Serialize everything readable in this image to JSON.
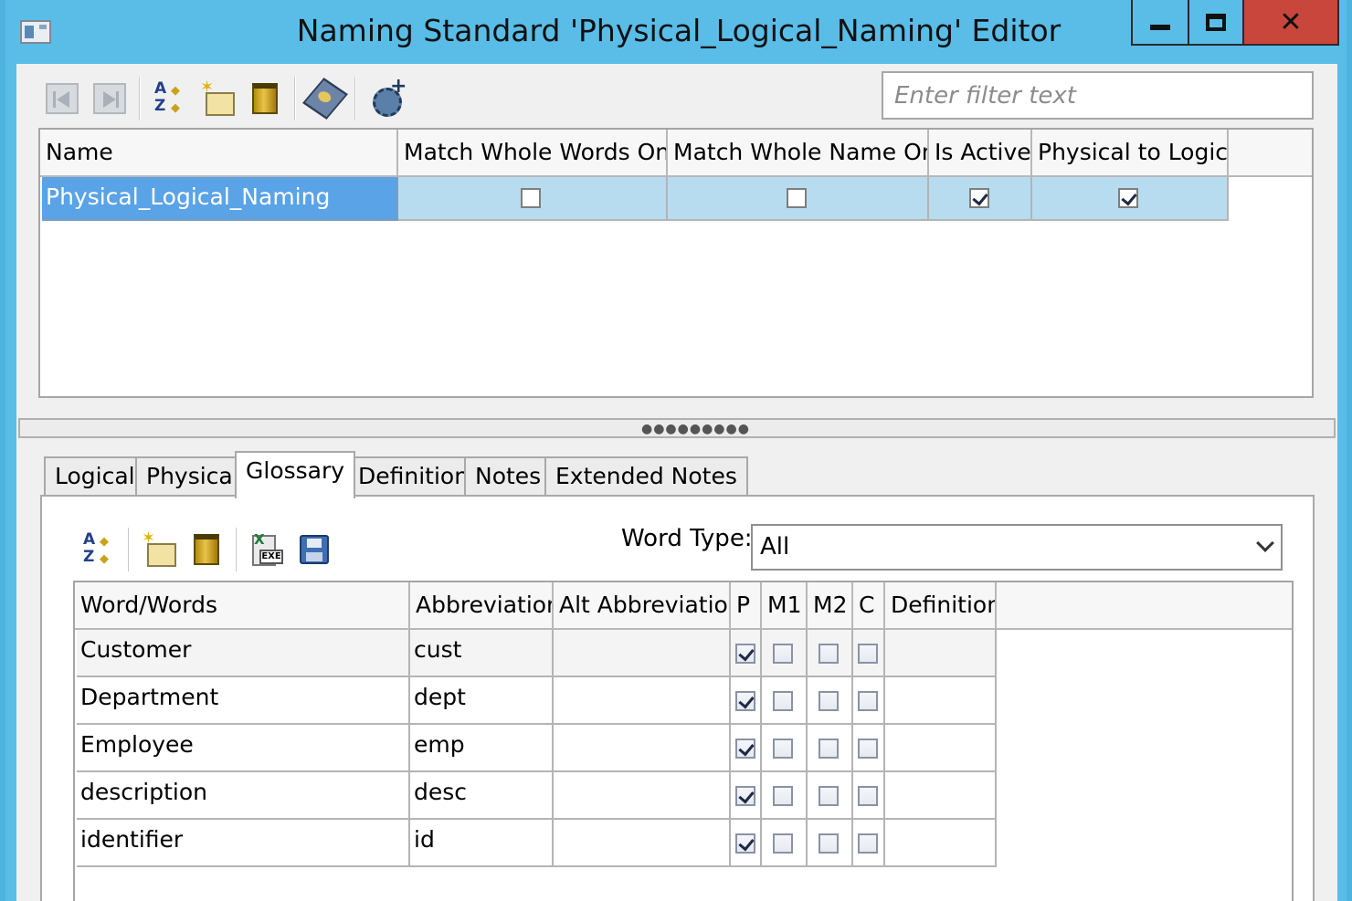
{
  "window": {
    "title": "Naming Standard 'Physical_Logical_Naming' Editor"
  },
  "toolbar": {
    "filter_placeholder": "Enter filter text"
  },
  "standards_table": {
    "columns": [
      "Name",
      "Match Whole Words Only",
      "Match Whole Name Only",
      "Is Active",
      "Physical to Logical"
    ],
    "rows": [
      {
        "name": "Physical_Logical_Naming",
        "match_whole_words_only": false,
        "match_whole_name_only": false,
        "is_active": true,
        "physical_to_logical": true,
        "selected": true
      }
    ]
  },
  "tabs": [
    {
      "label": "Logical",
      "active": false
    },
    {
      "label": "Physical",
      "active": false
    },
    {
      "label": "Glossary",
      "active": true
    },
    {
      "label": "Definition",
      "active": false
    },
    {
      "label": "Notes",
      "active": false
    },
    {
      "label": "Extended Notes",
      "active": false
    }
  ],
  "glossary": {
    "word_type_label": "Word Type:",
    "word_type_value": "All",
    "columns": [
      "Word/Words",
      "Abbreviation",
      "Alt Abbreviation",
      "P",
      "M1",
      "M2",
      "C",
      "Definition"
    ],
    "rows": [
      {
        "word": "Customer",
        "abbreviation": "cust",
        "alt_abbreviation": "",
        "p": true,
        "m1": false,
        "m2": false,
        "c": false,
        "definition": ""
      },
      {
        "word": "Department",
        "abbreviation": "dept",
        "alt_abbreviation": "",
        "p": true,
        "m1": false,
        "m2": false,
        "c": false,
        "definition": ""
      },
      {
        "word": "Employee",
        "abbreviation": "emp",
        "alt_abbreviation": "",
        "p": true,
        "m1": false,
        "m2": false,
        "c": false,
        "definition": ""
      },
      {
        "word": "description",
        "abbreviation": "desc",
        "alt_abbreviation": "",
        "p": true,
        "m1": false,
        "m2": false,
        "c": false,
        "definition": ""
      },
      {
        "word": "identifier",
        "abbreviation": "id",
        "alt_abbreviation": "",
        "p": true,
        "m1": false,
        "m2": false,
        "c": false,
        "definition": ""
      }
    ]
  },
  "colors": {
    "window_frame": "#59bde8",
    "close_button": "#c9463d",
    "selection": "#5aa3e6"
  }
}
